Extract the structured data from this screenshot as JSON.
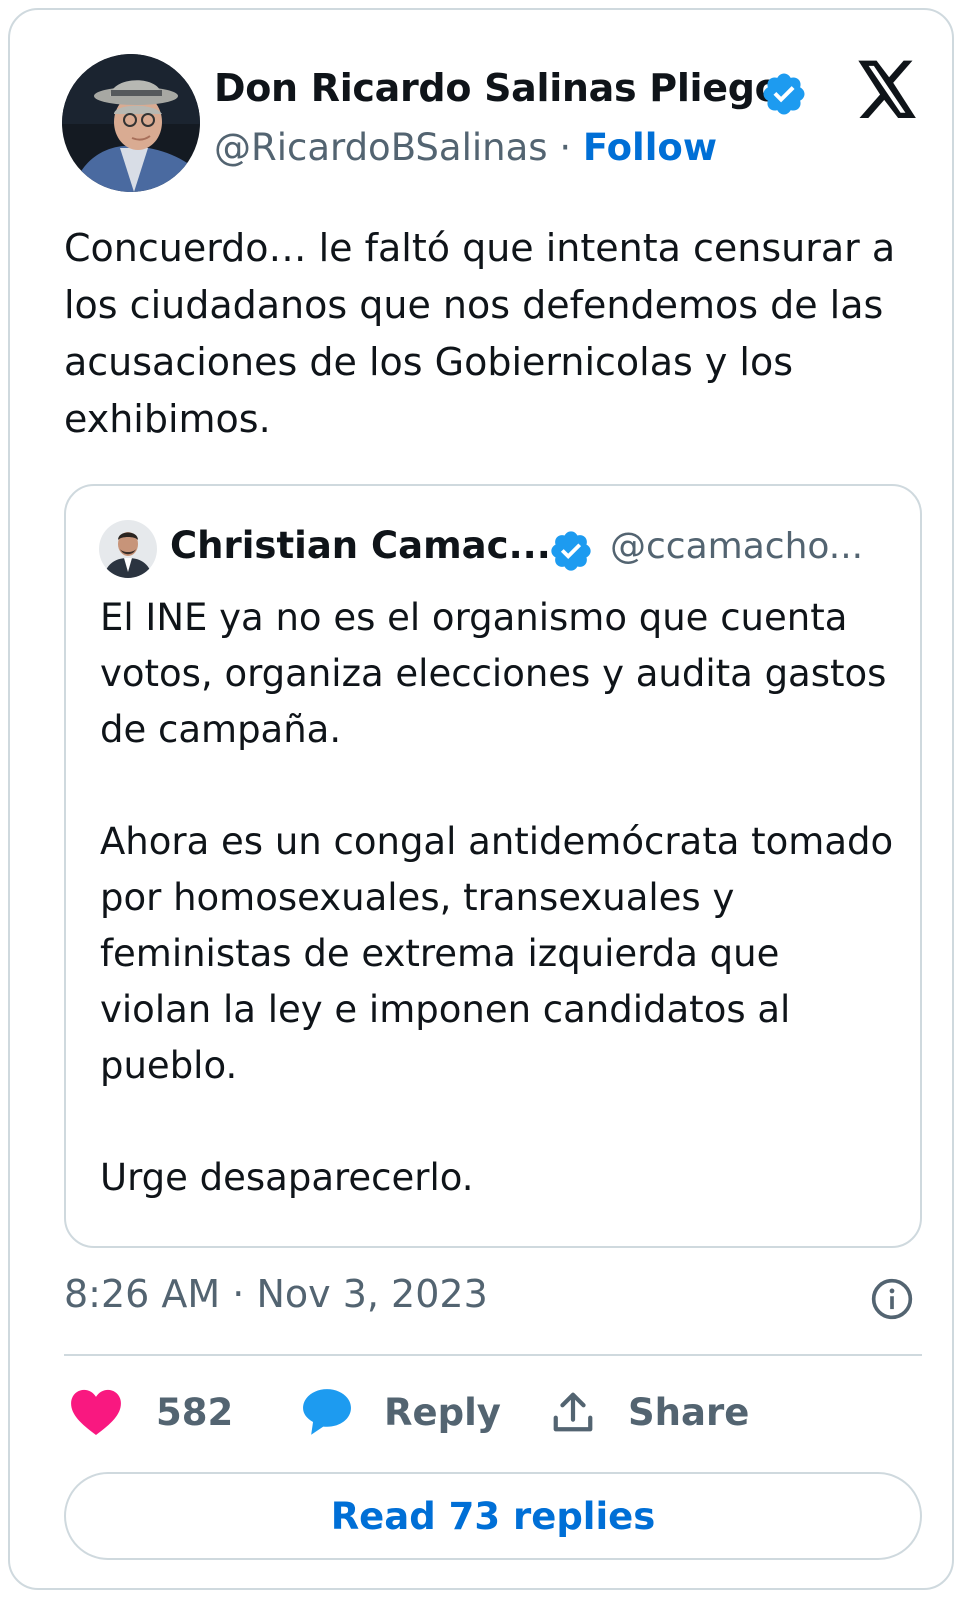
{
  "author": {
    "display_name": "Don Ricardo Salinas Pliego",
    "handle": "@RicardoBSalinas",
    "separator": "·",
    "follow_label": "Follow"
  },
  "tweet": {
    "text": "Concuerdo… le faltó que intenta censurar a los ciudadanos que nos defendemos de las acusaciones de los Gobiernicolas y los exhibimos."
  },
  "quoted_tweet": {
    "display_name": "Christian Camac...",
    "handle": "@ccamacho...",
    "paragraphs": [
      "El INE ya no es el organismo que cuenta votos, organiza elecciones y audita gastos de campaña.",
      "Ahora es un congal antidemócrata tomado por homosexuales, transexuales y feministas de extrema izquierda que violan la ley e imponen candidatos al pueblo.",
      "Urge desaparecerlo."
    ]
  },
  "meta": {
    "time": "8:26 AM",
    "separator": "·",
    "date": "Nov 3, 2023"
  },
  "actions": {
    "like_count": "582",
    "reply_label": "Reply",
    "share_label": "Share"
  },
  "read_replies_label": "Read 73 replies",
  "colors": {
    "accent_blue": "#006fd6",
    "verified_blue": "#1d9bf0",
    "like_pink": "#f91880",
    "secondary_text": "#536471",
    "border": "#cfd9de"
  },
  "icons": {
    "logo": "x-logo-icon",
    "verified": "verified-badge-icon",
    "info": "info-icon",
    "like": "heart-icon",
    "reply": "speech-bubble-icon",
    "share": "share-upload-icon"
  }
}
